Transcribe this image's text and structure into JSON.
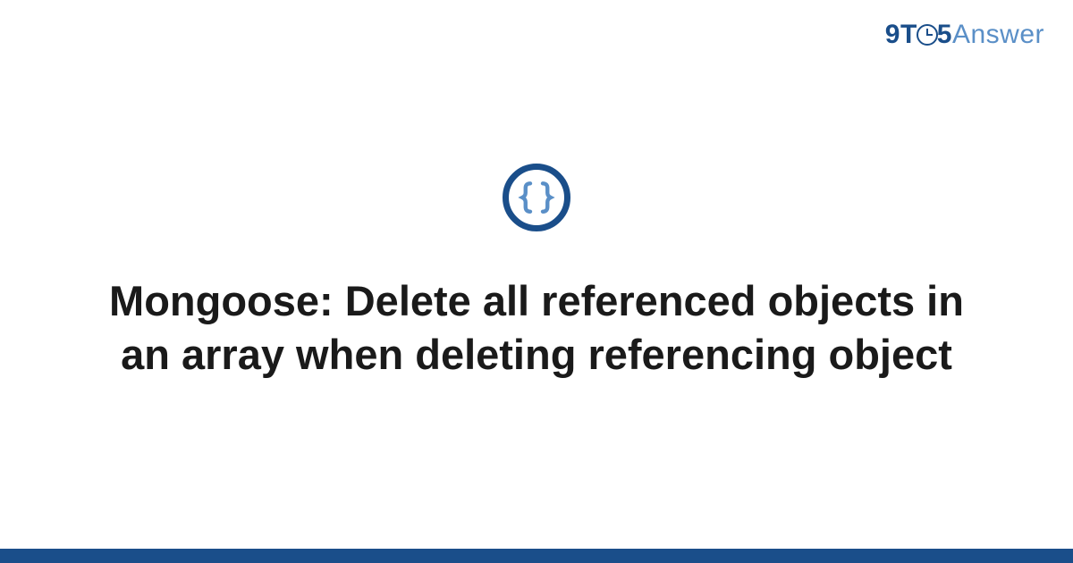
{
  "brand": {
    "part1": "9",
    "part2": "T",
    "part3": "5",
    "part4": "Answer"
  },
  "icon": {
    "name": "code-braces-icon",
    "ring_color": "#1a4e8a",
    "brace_color": "#5a8fc7"
  },
  "title": "Mongoose: Delete all referenced objects in an array when deleting referencing object",
  "colors": {
    "accent": "#1a4e8a",
    "accent_light": "#5a8fc7",
    "text": "#1a1a1a",
    "background": "#ffffff"
  }
}
